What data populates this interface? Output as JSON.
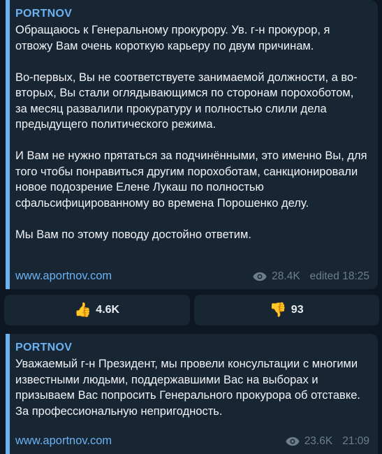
{
  "messages": [
    {
      "author": "PORTNOV",
      "paragraphs": [
        "Обращаюсь к Генеральному прокурору. Ув. г-н прокурор, я отвожу Вам очень короткую карьеру по двум причинам.",
        "Во-первых, Вы не соответствуете занимаемой должности, а во-вторых, Вы стали оглядывающимся по сторонам порохоботом, за месяц развалили прокуратуру и полностью слили дела предыдущего политического режима.",
        "И Вам не нужно прятаться за подчинёнными, это именно Вы, для того чтобы понравиться другим порохоботам, санкционировали новое подозрение Елене Лукаш по полностью сфальсифицированному во времена Порошенко делу.",
        "Мы Вам по этому поводу достойно ответим."
      ],
      "link": "www.aportnov.com",
      "views": "28.4K",
      "time": "edited 18:25"
    },
    {
      "author": "PORTNOV",
      "paragraphs": [
        "Уважаемый г-н Президент, мы провели консультации с многими известными людьми, поддержавшими Вас на выборах и призываем Вас попросить Генерального прокурора об отставке. За профессиональную непригодность."
      ],
      "link": "www.aportnov.com",
      "views": "23.6K",
      "time": "21:09"
    }
  ],
  "reactions": {
    "like": {
      "emoji": "👍",
      "count": "4.6K"
    },
    "dislike": {
      "emoji": "👎",
      "count": "93"
    }
  },
  "colors": {
    "background": "#0e1621",
    "bubble": "#182533",
    "accent": "#6ab2f2",
    "meta": "#6d7f8f",
    "thumb": "#f4b400"
  },
  "icons": {
    "views": "eye-icon",
    "like": "thumbs-up-icon",
    "dislike": "thumbs-down-icon"
  }
}
